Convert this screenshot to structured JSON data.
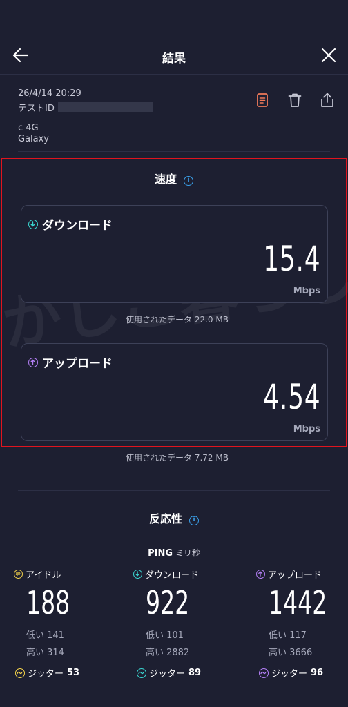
{
  "header": {
    "title": "結果"
  },
  "meta": {
    "date": "26/4/14 20:29",
    "test_id_label": "テストID",
    "network": "c 4G",
    "device": "Galaxy"
  },
  "speed": {
    "title": "速度",
    "download": {
      "label": "ダウンロード",
      "value": "15.4",
      "unit": "Mbps",
      "data_used": "使用されたデータ 22.0 MB"
    },
    "upload": {
      "label": "アップロード",
      "value": "4.54",
      "unit": "Mbps",
      "data_used": "使用されたデータ 7.72 MB"
    }
  },
  "watermark": "かしこ暮らし",
  "responsiveness": {
    "title": "反応性",
    "ping_label": "PING",
    "ping_unit": "ミリ秒",
    "columns": [
      {
        "label": "アイドル",
        "value": "188",
        "low": "低い 141",
        "high": "高い 314",
        "jitter_label": "ジッター",
        "jitter_value": "53"
      },
      {
        "label": "ダウンロード",
        "value": "922",
        "low": "低い 101",
        "high": "高い 2882",
        "jitter_label": "ジッター",
        "jitter_value": "89"
      },
      {
        "label": "アップロード",
        "value": "1442",
        "low": "低い 117",
        "high": "高い 3666",
        "jitter_label": "ジッター",
        "jitter_value": "96"
      }
    ]
  },
  "colors": {
    "background": "#1d1f31",
    "download_accent": "#3ad6d1",
    "upload_accent": "#b37ff5",
    "idle_accent": "#f2d14a",
    "info_accent": "#3aa0ea",
    "report_icon": "#f07a5a",
    "highlight_frame": "#e0141e"
  },
  "icons": {
    "back": "arrow-left-icon",
    "close": "close-icon",
    "report": "document-icon",
    "delete": "trash-icon",
    "share": "share-icon"
  }
}
